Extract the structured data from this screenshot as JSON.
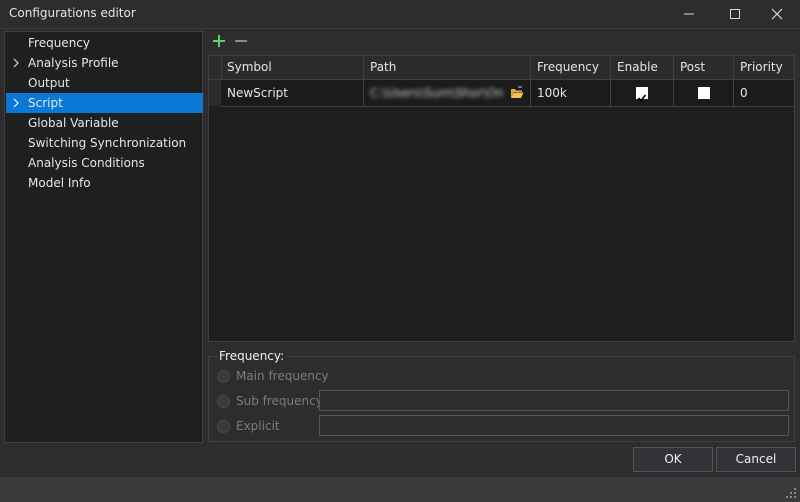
{
  "window": {
    "title": "Configurations editor",
    "controls": [
      "minimize-icon",
      "maximize-icon",
      "close-icon"
    ]
  },
  "nav": {
    "items": [
      {
        "label": "Frequency",
        "expandable": false,
        "selected": false
      },
      {
        "label": "Analysis Profile",
        "expandable": true,
        "selected": false
      },
      {
        "label": "Output",
        "expandable": false,
        "selected": false
      },
      {
        "label": "Script",
        "expandable": true,
        "selected": true
      },
      {
        "label": "Global Variable",
        "expandable": false,
        "selected": false
      },
      {
        "label": "Switching Synchronization",
        "expandable": false,
        "selected": false
      },
      {
        "label": "Analysis Conditions",
        "expandable": false,
        "selected": false
      },
      {
        "label": "Model Info",
        "expandable": false,
        "selected": false
      }
    ]
  },
  "toolbar": {
    "add_icon": "plus-icon",
    "remove_icon": "minus-icon"
  },
  "grid": {
    "columns": [
      "Symbol",
      "Path",
      "Frequency",
      "Enable",
      "Post",
      "Priority"
    ],
    "rows": [
      {
        "symbol": "NewScript",
        "path": "C:\\Users\\Sum\\Shor\\On",
        "frequency": "100k",
        "enable": true,
        "post": false,
        "priority": "0"
      }
    ]
  },
  "frequency_group": {
    "title": "Frequency:",
    "options": [
      {
        "label": "Main frequency",
        "has_input": false,
        "value": ""
      },
      {
        "label": "Sub frequency",
        "has_input": true,
        "value": ""
      },
      {
        "label": "Explicit",
        "has_input": true,
        "value": ""
      }
    ]
  },
  "buttons": {
    "ok": "OK",
    "cancel": "Cancel"
  },
  "colors": {
    "selection": "#0a78d7",
    "add_icon": "#5fcf6a",
    "folder_icon": "#e8a93b"
  }
}
